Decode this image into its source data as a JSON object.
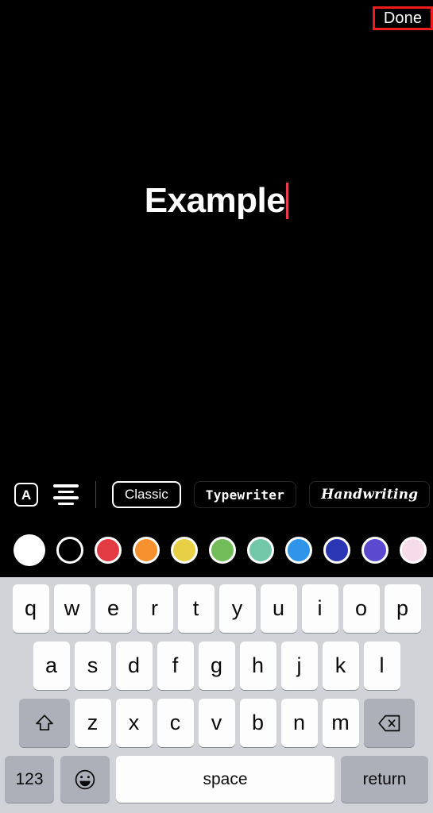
{
  "topbar": {
    "done_label": "Done",
    "annotation_color": "#ee1c1c"
  },
  "canvas": {
    "text_value": "Example",
    "caret_color": "#f03a4a",
    "background_color": "#000000",
    "text_color": "#ffffff"
  },
  "style_toolbar": {
    "text_background_icon": "a-in-box-icon",
    "alignment_icon": "align-center-icon",
    "fonts": [
      {
        "label": "Classic",
        "selected": true
      },
      {
        "label": "Typewriter",
        "selected": false
      },
      {
        "label": "Handwriting",
        "selected": false
      }
    ]
  },
  "color_palette": {
    "selected_index": 0,
    "swatches": [
      {
        "name": "white",
        "hex": "#ffffff",
        "selected": true
      },
      {
        "name": "black",
        "hex": "#000000",
        "selected": false
      },
      {
        "name": "red",
        "hex": "#e33b44",
        "selected": false
      },
      {
        "name": "orange",
        "hex": "#f7912f",
        "selected": false
      },
      {
        "name": "yellow",
        "hex": "#e8d046",
        "selected": false
      },
      {
        "name": "green",
        "hex": "#72bd5a",
        "selected": false
      },
      {
        "name": "teal-green",
        "hex": "#72c7a8",
        "selected": false
      },
      {
        "name": "blue",
        "hex": "#2e95eb",
        "selected": false
      },
      {
        "name": "dark-blue",
        "hex": "#2b36b4",
        "selected": false
      },
      {
        "name": "purple",
        "hex": "#5a4acf",
        "selected": false
      },
      {
        "name": "pale-pink",
        "hex": "#f6dce9",
        "selected": false
      }
    ]
  },
  "keyboard": {
    "row1": [
      "q",
      "w",
      "e",
      "r",
      "t",
      "y",
      "u",
      "i",
      "o",
      "p"
    ],
    "row2": [
      "a",
      "s",
      "d",
      "f",
      "g",
      "h",
      "j",
      "k",
      "l"
    ],
    "row3": [
      "z",
      "x",
      "c",
      "v",
      "b",
      "n",
      "m"
    ],
    "shift_icon": "shift-arrow-icon",
    "delete_icon": "backspace-delete-icon",
    "numeric_label": "123",
    "emoji_icon": "smiley-face-icon",
    "space_label": "space",
    "return_label": "return",
    "background_color": "#d1d3d9",
    "key_color": "#fdfdfd",
    "modifier_key_color": "#adb0b9"
  }
}
